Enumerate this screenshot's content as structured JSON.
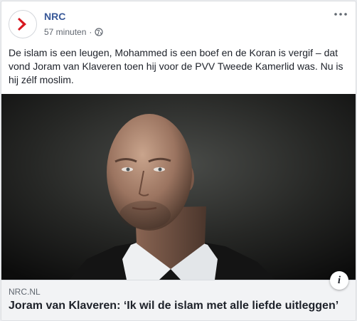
{
  "post": {
    "page_name": "NRC",
    "timestamp": "57 minuten",
    "separator": "·",
    "privacy_icon": "globe-icon",
    "more_icon": "more-dots-icon",
    "text": "De islam is een leugen, Mohammed is een boef en de Koran is vergif – dat vond Joram van Klaveren toen hij voor de PVV Tweede Kamerlid was. Nu is hij zélf moslim."
  },
  "link": {
    "domain": "NRC.NL",
    "headline": "Joram van Klaveren: ‘Ik wil de islam met alle liefde uitleggen’",
    "info_glyph": "i"
  },
  "colors": {
    "brand_red": "#d71920",
    "link_blue": "#385898",
    "text": "#1d2129",
    "muted": "#616770"
  }
}
